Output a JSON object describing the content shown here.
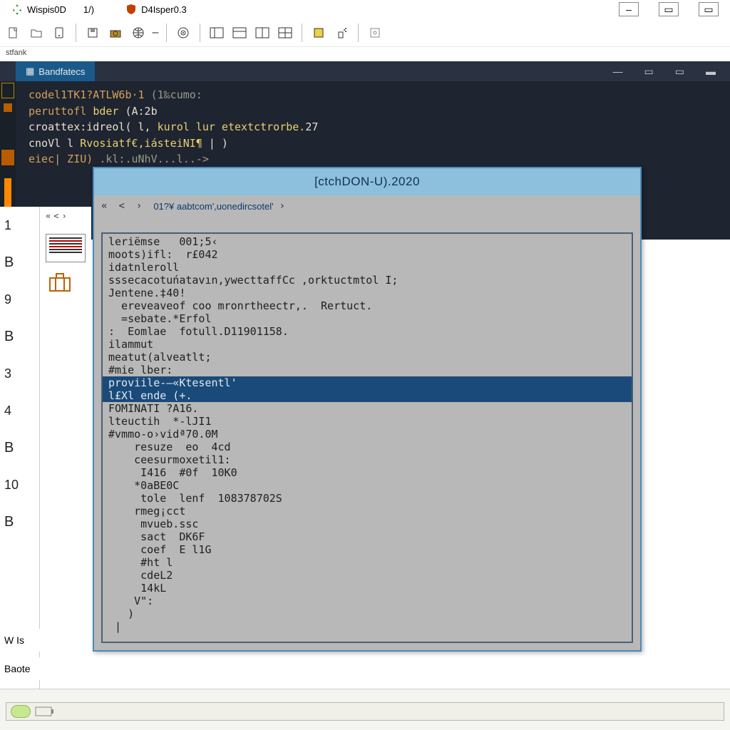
{
  "titlebar": {
    "tab1": "Wispis0D",
    "tab1_count": "1/)",
    "tab2": "D4Isper0.3"
  },
  "toolbar_strip_label": "stfank",
  "dark_panel": {
    "tab": "Bandfatecs",
    "code_lines": [
      {
        "segs": [
          [
            "c-or",
            "codel1TK1?ATLW6b·1 "
          ],
          [
            "c-gr",
            "(1‰cumo:"
          ]
        ]
      },
      {
        "segs": [
          [
            "c-or",
            "peruttofl  "
          ],
          [
            "c-yl",
            "bder  "
          ],
          [
            "c-wh",
            "(A:2b"
          ]
        ]
      },
      {
        "segs": [
          [
            "c-wh",
            "croattex:idreol(   l,  "
          ],
          [
            "c-yl",
            "kurol  lur  etextctrorbe."
          ],
          [
            "c-wh",
            "27"
          ]
        ]
      },
      {
        "segs": [
          [
            "c-wh",
            "cnoVl l   "
          ],
          [
            "c-yl",
            "Rvosiatf€,iásteiNI¶"
          ],
          [
            "c-wh",
            "  | )"
          ]
        ]
      },
      {
        "segs": [
          [
            "c-or",
            "eiec| ZIU)  "
          ],
          [
            "c-gr",
            ".kl:.uNhV...l..->"
          ]
        ]
      }
    ]
  },
  "ruler": [
    "1",
    "B",
    "9",
    "B",
    "3",
    "4",
    "B",
    "10",
    "B"
  ],
  "dialog": {
    "title": "[ctchDON-U).2020",
    "breadcrumb": "01?¥ aabtcom',uonedircsotel'",
    "rows": [
      {
        "t": "leriëmse   001;5‹"
      },
      {
        "t": "moots)ifl:  r£042"
      },
      {
        "t": "idatnleroll"
      },
      {
        "t": "sssecacotuńatavın‚ywecttaffCc ,orktuctmtol I;"
      },
      {
        "t": "Jentene.‡40!"
      },
      {
        "t": "  ereveaveof coo mronrtheectr,.  Rertuct."
      },
      {
        "t": "  =sebate.*Erfol"
      },
      {
        "t": ":  Eomlae  fotull.D11901158."
      },
      {
        "t": "ilammut"
      },
      {
        "t": "meatut(alveatlt;"
      },
      {
        "t": "#mie lber:"
      },
      {
        "t": "proviile-—«Ktesentl'",
        "sel": true
      },
      {
        "t": "l£Xl ende (+.",
        "sel": true
      },
      {
        "t": "FOMINATI ?A16."
      },
      {
        "t": "lteuctih  *‑lJI1"
      },
      {
        "t": "#vmmo‑o›vidª70.0M"
      },
      {
        "t": "    resuze  eo  4cd"
      },
      {
        "t": "    ceesurmoxetil1:"
      },
      {
        "t": "     I416  #0f  10K0"
      },
      {
        "t": "    *0aBE0C"
      },
      {
        "t": "     tole  lenf  108378702S"
      },
      {
        "t": "    rmeg¡cct"
      },
      {
        "t": "     mvueb.ssc"
      },
      {
        "t": "     sact  DK6F"
      },
      {
        "t": "     coef  E l1G"
      },
      {
        "t": "     #ht l"
      },
      {
        "t": "     cdeL2"
      },
      {
        "t": "     14kL"
      },
      {
        "t": "    V\":"
      },
      {
        "t": "   )"
      },
      {
        "t": " |"
      }
    ]
  },
  "bottom_labels": {
    "a": "W Is",
    "b": "Baote"
  }
}
